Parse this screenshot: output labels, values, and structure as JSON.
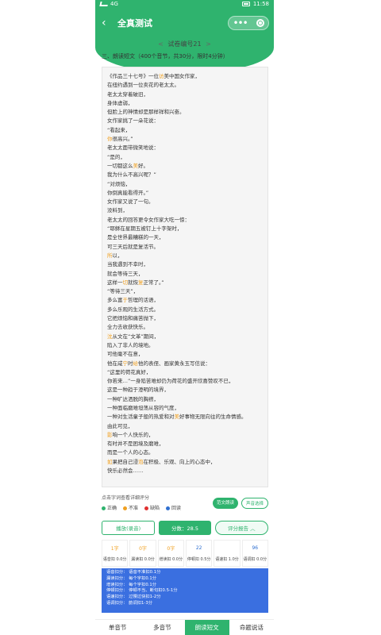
{
  "status": {
    "time": "11:58",
    "left_text": "4G"
  },
  "header": {
    "title": "全真测试",
    "back": "‹",
    "capsule_dots": "•••"
  },
  "paper": {
    "id_label": "试卷编号21",
    "prev": "<",
    "next": ">"
  },
  "section": {
    "title": "三、朗读短文（400个音节，共30分，限时4分钟）"
  },
  "text_lines": [
    [
      {
        "t": "《作品三十七号》一位"
      },
      {
        "t": "访",
        "c": "o"
      },
      {
        "t": "美中国女作家，"
      }
    ],
    [
      {
        "t": "在纽约遇到一位卖花的老太太。"
      }
    ],
    [
      {
        "t": "老太太穿着破旧，"
      }
    ],
    [
      {
        "t": "身体虚弱，"
      }
    ],
    [
      {
        "t": "但脸上的神情却是那样祥和兴奋。"
      }
    ],
    [
      {
        "t": "女作家挑了一朵花说："
      }
    ],
    [
      {
        "t": "“看起来，"
      }
    ],
    [
      {
        "t": "你",
        "c": "o"
      },
      {
        "t": "很高兴。”"
      }
    ],
    [
      {
        "t": "老太太面带微笑地说："
      }
    ],
    [
      {
        "t": "“是的，"
      }
    ],
    [
      {
        "t": "一切都这么"
      },
      {
        "t": "美",
        "c": "o"
      },
      {
        "t": "好。"
      }
    ],
    [
      {
        "t": "我为什么不高兴呢？”"
      }
    ],
    [
      {
        "t": "“对烦恼，"
      }
    ],
    [
      {
        "t": "你倒真能看得开。”"
      }
    ],
    [
      {
        "t": "女作家又说了一句。"
      }
    ],
    [
      {
        "t": "没料到，"
      }
    ],
    [
      {
        "t": "老太太的回答更令女作家大吃一惊："
      }
    ],
    [
      {
        "t": "“耶稣在星期五被钉上十字架时，"
      }
    ],
    [
      {
        "t": "是全世界最糟糕的一天，"
      }
    ],
    [
      {
        "t": "可三天后就是复活节。"
      }
    ],
    [
      {
        "t": "所",
        "c": "o"
      },
      {
        "t": "以，"
      }
    ],
    [
      {
        "t": "当我遇到不幸时，"
      }
    ],
    [
      {
        "t": "就会等待三天，"
      }
    ],
    [
      {
        "t": "这样一"
      },
      {
        "t": "切",
        "c": "o"
      },
      {
        "t": "就恢"
      },
      {
        "t": "复",
        "c": "o"
      },
      {
        "t": "正常了。”"
      }
    ],
    [
      {
        "t": "“等待三天”，"
      }
    ],
    [
      {
        "t": "多么富"
      },
      {
        "t": "于",
        "c": "o"
      },
      {
        "t": "哲理的话语，"
      }
    ],
    [
      {
        "t": "多么乐观的生活方式。"
      }
    ],
    [
      {
        "t": "它把烦恼和痛苦抛下，"
      }
    ],
    [
      {
        "t": "全力去收获快乐。"
      }
    ],
    [
      {
        "t": "沈",
        "c": "o"
      },
      {
        "t": "从文在“文革”期间，"
      }
    ],
    [
      {
        "t": "陷入了非人的境地。"
      }
    ],
    [
      {
        "t": "可他毫不在意，"
      }
    ],
    [
      {
        "t": "他在咸"
      },
      {
        "t": "宁",
        "c": "o"
      },
      {
        "t": "时"
      },
      {
        "t": "给",
        "c": "o"
      },
      {
        "t": "他的表侄、画家黄永玉写信说："
      }
    ],
    [
      {
        "t": "“这里的荷花真好，"
      }
    ],
    [
      {
        "t": "你若来…”一身陷苦难却仍为荷花的盛开欣喜赞叹不已，",
        "wrap": true
      }
    ],
    [
      {
        "t": "这是一种趋于澄明的境界，"
      }
    ],
    [
      {
        "t": "一种旷达洒脱的胸襟，"
      }
    ],
    [
      {
        "t": "一种面临磨难坦荡从容的气度，"
      }
    ],
    [
      {
        "t": "一种对生活童子般的热爱和对"
      },
      {
        "t": "美",
        "c": "o"
      },
      {
        "t": "好事物无限向往的生命情感。",
        "wrap": true
      }
    ],
    [
      {
        "t": "由此可见，"
      }
    ],
    [
      {
        "t": "影",
        "c": "o"
      },
      {
        "t": "响一个人快乐的，"
      }
    ],
    [
      {
        "t": "有时并不是困境及磨难，"
      }
    ],
    [
      {
        "t": "而是一个人的心态。"
      }
    ],
    [
      {
        "t": "如",
        "c": "o"
      },
      {
        "t": "果把自己浸"
      },
      {
        "t": "泡",
        "c": "o"
      },
      {
        "t": "在积极、乐观、向上的心态中，"
      }
    ],
    [
      {
        "t": "快乐必然会……"
      }
    ]
  ],
  "legend": {
    "hint": "点击字词查看详细评分",
    "items": [
      {
        "label": "正确",
        "color": "#2fb36e"
      },
      {
        "label": "不准",
        "color": "#f0a020"
      },
      {
        "label": "缺陷",
        "color": "#e03030"
      },
      {
        "label": "回读",
        "color": "#3070d0"
      }
    ],
    "btn_demo": "范文朗读",
    "btn_voice": "声音选择"
  },
  "actions": {
    "play": "播放(录音)",
    "score": "分数：28.5",
    "report": "评分报告 ︿"
  },
  "cards": [
    {
      "val": "1字",
      "label": "语音扣 0.0分",
      "color": "#f0a020"
    },
    {
      "val": "0字",
      "label": "漏读扣 0.0分",
      "color": "#f0a020"
    },
    {
      "val": "0字",
      "label": "增读扣 0.0分",
      "color": "#f0a020"
    },
    {
      "val": "22",
      "label": "停顿扣 0.5分",
      "color": "#3070d0"
    },
    {
      "val": "",
      "label": "语速扣 1.0分",
      "color": "#3070d0"
    },
    {
      "val": "96",
      "label": "语调扣 0.0分",
      "color": "#3070d0"
    }
  ],
  "rules": [
    "语音扣分：  语音不准扣0.1分",
    "漏读扣分：  每个字扣0.1分",
    "增读扣分：  每个字扣0.1分",
    "停顿扣分：  停顿不当、断句扣0.5-1分",
    "语速扣分：  过慢过快扣1-2分",
    "语调扣分：  韵调扣1-3分"
  ],
  "watermark": " ",
  "tabs": [
    {
      "label": "单音节",
      "active": false
    },
    {
      "label": "多音节",
      "active": false
    },
    {
      "label": "朗读短文",
      "active": true
    },
    {
      "label": "命题说话",
      "active": false
    }
  ],
  "colors": {
    "brand": "#2fb36e",
    "orange": "#f0a020",
    "rules_bg": "#3a6fe0"
  }
}
